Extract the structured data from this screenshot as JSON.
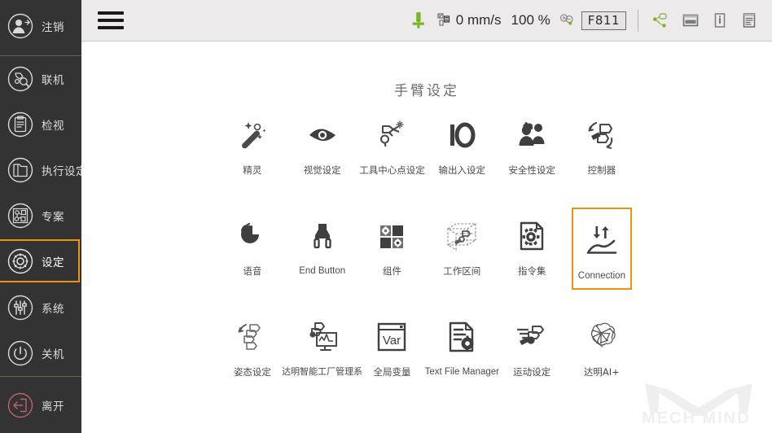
{
  "sidebar": {
    "items": [
      {
        "label": "注销",
        "icon": "logout-user-icon",
        "selected": false,
        "accent": "#d8d8d8"
      },
      {
        "label": "联机",
        "icon": "connect-robot-icon",
        "selected": false,
        "accent": "#d8d8d8"
      },
      {
        "label": "检视",
        "icon": "monitor-list-icon",
        "selected": false,
        "accent": "#d8d8d8"
      },
      {
        "label": "执行设定",
        "icon": "run-settings-folder-icon",
        "selected": false,
        "accent": "#d8d8d8"
      },
      {
        "label": "专案",
        "icon": "project-flow-icon",
        "selected": false,
        "accent": "#d8d8d8"
      },
      {
        "label": "设定",
        "icon": "gear-icon",
        "selected": true,
        "accent": "#ffffff"
      },
      {
        "label": "系统",
        "icon": "sliders-icon",
        "selected": false,
        "accent": "#d8d8d8"
      },
      {
        "label": "关机",
        "icon": "power-icon",
        "selected": false,
        "accent": "#d8d8d8"
      },
      {
        "label": "离开",
        "icon": "exit-door-icon",
        "selected": false,
        "accent": "#c06070"
      }
    ],
    "selected_border_color": "#f0900f",
    "divider_color": "#5c6b45",
    "background": "#333333"
  },
  "topbar": {
    "menu_icon": "hamburger-menu-icon",
    "robot_state_icon": "robot-arm-status-icon",
    "speed_icon": "speed-gauge-icon",
    "speed_value": "0 mm/s",
    "override_value": "100 %",
    "zoom_icon": "zoom-in-out-icon",
    "function_key": "F811",
    "net_icon": "network-node-icon",
    "device_icon": "controller-box-icon",
    "info_icon": "info-icon",
    "log_icon": "log-document-icon",
    "background": "#eceaea",
    "accent_green": "#7ab51d"
  },
  "main": {
    "title": "手臂设定",
    "rows": [
      {
        "cells": [
          {
            "label": "精灵",
            "icon": "magic-wand-icon",
            "lang": "zh",
            "selected": false
          },
          {
            "label": "视觉设定",
            "icon": "eye-vision-icon",
            "lang": "zh",
            "selected": false
          },
          {
            "label": "工具中心点设定",
            "icon": "tcp-tool-center-point-icon",
            "lang": "zh",
            "selected": false
          },
          {
            "label": "输出入设定",
            "icon": "io-icon",
            "lang": "zh",
            "selected": false
          },
          {
            "label": "安全性设定",
            "icon": "safety-people-icon",
            "lang": "zh",
            "selected": false
          },
          {
            "label": "控制器",
            "icon": "controller-icon",
            "lang": "zh",
            "selected": false
          }
        ]
      },
      {
        "cells": [
          {
            "label": "语音",
            "icon": "voice-speech-icon",
            "lang": "zh",
            "selected": false
          },
          {
            "label": "End Button",
            "icon": "end-button-gripper-icon",
            "lang": "en",
            "selected": false
          },
          {
            "label": "组件",
            "icon": "components-puzzle-icon",
            "lang": "zh",
            "selected": false
          },
          {
            "label": "工作区间",
            "icon": "workspace-cube-icon",
            "lang": "zh",
            "selected": false
          },
          {
            "label": "指令集",
            "icon": "command-set-gear-doc-icon",
            "lang": "zh",
            "selected": false
          },
          {
            "label": "Connection",
            "icon": "connection-arrows-icon",
            "lang": "en",
            "selected": true
          }
        ]
      },
      {
        "cells": [
          {
            "label": "姿态设定",
            "icon": "pose-settings-icon",
            "lang": "zh",
            "selected": false
          },
          {
            "label": "达明智能工厂管理系",
            "icon": "smart-factory-monitor-icon",
            "lang": "zh",
            "selected": false
          },
          {
            "label": "全局变量",
            "icon": "global-variable-icon",
            "lang": "zh",
            "selected": false,
            "glyph": "Var"
          },
          {
            "label": "Text File Manager",
            "icon": "text-file-manager-icon",
            "lang": "en",
            "selected": false
          },
          {
            "label": "运动设定",
            "icon": "motion-settings-icon",
            "lang": "zh",
            "selected": false
          },
          {
            "label": "达明AI+",
            "icon": "ai-brain-network-icon",
            "lang": "zh",
            "selected": false
          }
        ]
      }
    ],
    "selected_border_color": "#f0900f"
  },
  "watermark": {
    "text": "MECH MIND",
    "icon": "mech-mind-logo"
  }
}
